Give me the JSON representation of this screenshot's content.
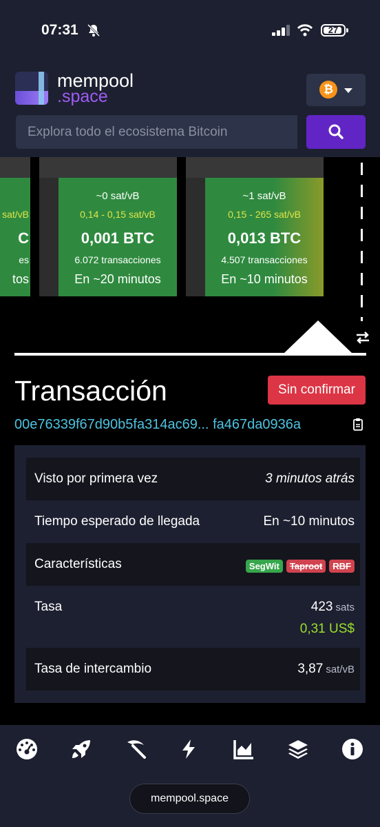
{
  "status_bar": {
    "time": "07:31",
    "battery": "27",
    "icons": [
      "bell-slash-icon",
      "signal-icon",
      "wifi-icon",
      "battery-icon"
    ]
  },
  "header": {
    "logo_line1": "mempool",
    "logo_line2": ".space",
    "network_icon": "bitcoin-icon",
    "search_placeholder": "Explora todo el ecosistema Bitcoin",
    "search_icon": "search-icon"
  },
  "blocks": [
    {
      "fee": "",
      "range": "sat/vB",
      "size": "C",
      "tx": "es",
      "eta": "tos"
    },
    {
      "fee": "~0 sat/vB",
      "range": "0,14 - 0,15 sat/vB",
      "size": "0,001 BTC",
      "tx": "6.072 transacciones",
      "eta": "En ~20 minutos"
    },
    {
      "fee": "~1 sat/vB",
      "range": "0,15 - 265 sat/vB",
      "size": "0,013 BTC",
      "tx": "4.507 transacciones",
      "eta": "En ~10 minutos"
    }
  ],
  "colors": {
    "block_green": "#2f8a3f",
    "block_yellow": "#8a9a2a",
    "accent": "#6225c5",
    "header_bg": "#1d2030",
    "unconfirmed_red": "#dc3545",
    "txid_blue": "#4ec3e0"
  },
  "transaction": {
    "title": "Transacción",
    "status": "Sin confirmar",
    "txid_start": "00e76339f67d90b5fa314ac69...",
    "txid_end": "fa467da0936a",
    "rows": {
      "first_seen_label": "Visto por primera vez",
      "first_seen_value": "3 minutos atrás",
      "eta_label": "Tiempo esperado de llegada",
      "eta_value": "En ~10 minutos",
      "features_label": "Características",
      "features": [
        "SegWit",
        "Taproot",
        "RBF"
      ],
      "fee_label": "Tasa",
      "fee_value": "423",
      "fee_unit": "sats",
      "fee_usd": "0,31 US$",
      "rate_label": "Tasa de intercambio",
      "rate_value": "3,87",
      "rate_unit": "sat/vB"
    }
  },
  "bottom_nav": {
    "icons": [
      "dashboard-icon",
      "rocket-icon",
      "pickaxe-icon",
      "lightning-icon",
      "chart-icon",
      "layers-icon",
      "info-icon"
    ],
    "url": "mempool.space"
  }
}
